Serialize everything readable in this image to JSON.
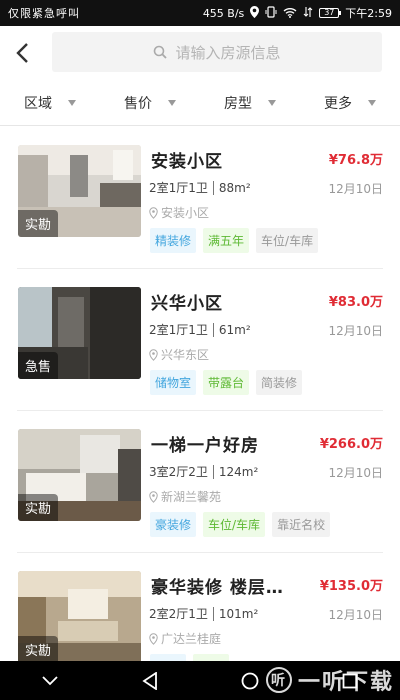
{
  "status_bar": {
    "left_text": "仅限紧急呼叫",
    "speed": "455 B/s",
    "battery": "37",
    "time": "下午2:59"
  },
  "search": {
    "placeholder": "请输入房源信息"
  },
  "filters": [
    {
      "label": "区域"
    },
    {
      "label": "售价"
    },
    {
      "label": "房型"
    },
    {
      "label": "更多"
    }
  ],
  "listings": [
    {
      "title": "安装小区",
      "price": "¥76.8万",
      "layout": "2室1厅1卫",
      "area": "88m²",
      "date": "12月10日",
      "address": "安装小区",
      "badge": "实勘",
      "tags": [
        {
          "text": "精装修",
          "style": "blue"
        },
        {
          "text": "满五年",
          "style": "green"
        },
        {
          "text": "车位/车库",
          "style": "gray"
        }
      ]
    },
    {
      "title": "兴华小区",
      "price": "¥83.0万",
      "layout": "2室1厅1卫",
      "area": "61m²",
      "date": "12月10日",
      "address": "兴华东区",
      "badge": "急售",
      "tags": [
        {
          "text": "储物室",
          "style": "blue"
        },
        {
          "text": "带露台",
          "style": "green"
        },
        {
          "text": "简装修",
          "style": "gray"
        }
      ]
    },
    {
      "title": "一梯一户好房",
      "price": "¥266.0万",
      "layout": "3室2厅2卫",
      "area": "124m²",
      "date": "12月10日",
      "address": "新湖兰馨苑",
      "badge": "实勘",
      "tags": [
        {
          "text": "豪装修",
          "style": "blue"
        },
        {
          "text": "车位/车库",
          "style": "green"
        },
        {
          "text": "靠近名校",
          "style": "gray"
        }
      ]
    },
    {
      "title": "豪华装修 楼层…",
      "price": "¥135.0万",
      "layout": "2室2厅1卫",
      "area": "101m²",
      "date": "12月10日",
      "address": "广达兰桂庭",
      "badge": "实勘",
      "tags": [
        {
          "text": "",
          "style": "blue"
        },
        {
          "text": "",
          "style": "green"
        },
        {
          "text": "",
          "style": "gray"
        }
      ]
    }
  ],
  "watermark": {
    "text": "一听下载",
    "logo": "听"
  },
  "colors": {
    "price": "#e02c35",
    "tag_blue": "#43a6de",
    "tag_green": "#5eb934"
  }
}
